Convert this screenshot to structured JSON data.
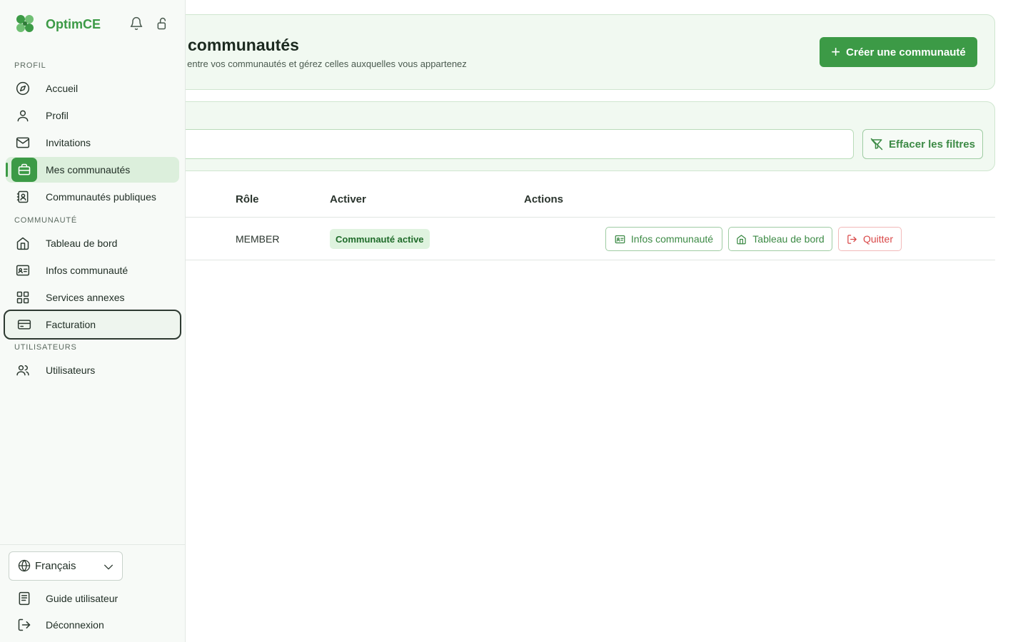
{
  "brand": {
    "name": "OptimCE",
    "accent": "#3c9a46"
  },
  "header": {
    "title": "communautés",
    "subtitle": "z entre vos communautés et gérez celles auxquelles vous appartenez",
    "create_label": "Créer une communauté"
  },
  "filters": {
    "search_placeholder": "",
    "clear_label": "Effacer les filtres"
  },
  "table": {
    "headers": {
      "role": "Rôle",
      "active": "Activer",
      "actions": "Actions"
    },
    "rows": [
      {
        "role": "MEMBER",
        "status": "Communauté active",
        "actions": {
          "info": "Infos communauté",
          "dashboard": "Tableau de bord",
          "quit": "Quitter"
        }
      }
    ]
  },
  "sidebar": {
    "sections": {
      "profile": "PROFIL",
      "community": "COMMUNAUTÉ",
      "users": "UTILISATEURS"
    },
    "profile_items": [
      {
        "label": "Accueil",
        "icon": "compass-icon"
      },
      {
        "label": "Profil",
        "icon": "user-icon"
      },
      {
        "label": "Invitations",
        "icon": "mail-icon"
      },
      {
        "label": "Mes communautés",
        "icon": "briefcase-icon"
      },
      {
        "label": "Communautés publiques",
        "icon": "contact-book-icon"
      }
    ],
    "community_items": [
      {
        "label": "Tableau de bord",
        "icon": "home-icon"
      },
      {
        "label": "Infos communauté",
        "icon": "id-card-icon"
      },
      {
        "label": "Services annexes",
        "icon": "grid-icon"
      },
      {
        "label": "Facturation",
        "icon": "credit-card-icon"
      }
    ],
    "users_items": [
      {
        "label": "Utilisateurs",
        "icon": "users-icon"
      }
    ],
    "language": "Français",
    "footer": {
      "guide": "Guide utilisateur",
      "logout": "Déconnexion"
    }
  }
}
